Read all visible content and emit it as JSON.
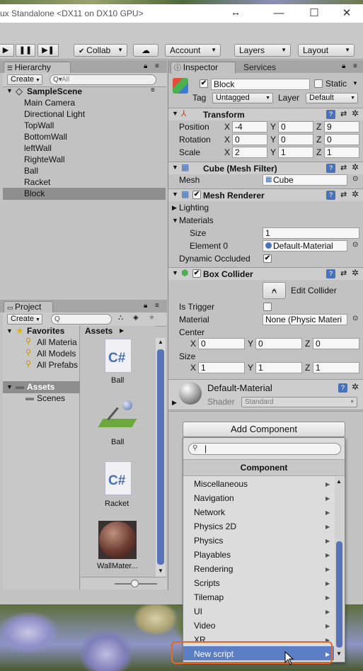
{
  "window": {
    "title": "ux Standalone <DX11 on DX10 GPU>",
    "resize_glyph": "↔",
    "minimize": "—",
    "maximize": "☐",
    "close": "✕"
  },
  "toolbar": {
    "play": "▶",
    "pause": "❚❚",
    "step": "▶❚",
    "collab": "Collab",
    "cloud": "☁",
    "account": "Account",
    "layers": "Layers",
    "layout": "Layout"
  },
  "hierarchy": {
    "tab": "Hierarchy",
    "create": "Create",
    "search_placeholder": "All",
    "scene": "SampleScene",
    "items": [
      "Main Camera",
      "Directional Light",
      "TopWall",
      "BottomWall",
      "leftWall",
      "RighteWall",
      "Ball",
      "Racket",
      "Block"
    ],
    "selected": "Block"
  },
  "project": {
    "tab": "Project",
    "create": "Create",
    "favorites": "Favorites",
    "favorite_items": [
      "All Materia",
      "All Models",
      "All Prefabs"
    ],
    "assets_folder": "Assets",
    "scenes_folder": "Scenes",
    "breadcrumb": "Assets",
    "assets": [
      {
        "icon": "csharp-icon",
        "glyph": "C#",
        "label": "Ball"
      },
      {
        "icon": "physic-material-icon",
        "glyph": "",
        "label": "Ball"
      },
      {
        "icon": "csharp-icon",
        "glyph": "C#",
        "label": "Racket"
      },
      {
        "icon": "material-sphere-icon",
        "glyph": "",
        "label": "WallMater..."
      }
    ]
  },
  "inspector": {
    "tab": "Inspector",
    "services_tab": "Services",
    "object_name": "Block",
    "static_label": "Static",
    "tag_label": "Tag",
    "tag_value": "Untagged",
    "layer_label": "Layer",
    "layer_value": "Default",
    "transform": {
      "title": "Transform",
      "position_label": "Position",
      "rotation_label": "Rotation",
      "scale_label": "Scale",
      "position": {
        "x": "-4",
        "y": "0",
        "z": "9"
      },
      "rotation": {
        "x": "0",
        "y": "0",
        "z": "0"
      },
      "scale": {
        "x": "2",
        "y": "1",
        "z": "1"
      }
    },
    "mesh_filter": {
      "title": "Cube (Mesh Filter)",
      "mesh_label": "Mesh",
      "mesh_value": "Cube"
    },
    "mesh_renderer": {
      "title": "Mesh Renderer",
      "lighting": "Lighting",
      "materials": "Materials",
      "size_label": "Size",
      "size_value": "1",
      "element0_label": "Element 0",
      "element0_value": "Default-Material",
      "dynamic_occluded": "Dynamic Occluded"
    },
    "box_collider": {
      "title": "Box Collider",
      "edit_collider": "Edit Collider",
      "is_trigger": "Is Trigger",
      "material_label": "Material",
      "material_value": "None (Physic Materi",
      "center_label": "Center",
      "center": {
        "x": "0",
        "y": "0",
        "z": "0"
      },
      "size_label": "Size",
      "size": {
        "x": "1",
        "y": "1",
        "z": "1"
      }
    },
    "material_preview": {
      "name": "Default-Material",
      "shader_label": "Shader",
      "shader_value": "Standard"
    },
    "add_component": "Add Component"
  },
  "component_menu": {
    "header": "Component",
    "items": [
      "Miscellaneous",
      "Navigation",
      "Network",
      "Physics 2D",
      "Physics",
      "Playables",
      "Rendering",
      "Scripts",
      "Tilemap",
      "UI",
      "Video",
      "XR",
      "New script"
    ],
    "highlighted": "New script"
  },
  "axis_labels": {
    "x": "X",
    "y": "Y",
    "z": "Z"
  },
  "colors": {
    "highlight": "#5b7ec5",
    "annotation_ring": "#e8661f",
    "selection": "#8e8e8e"
  }
}
